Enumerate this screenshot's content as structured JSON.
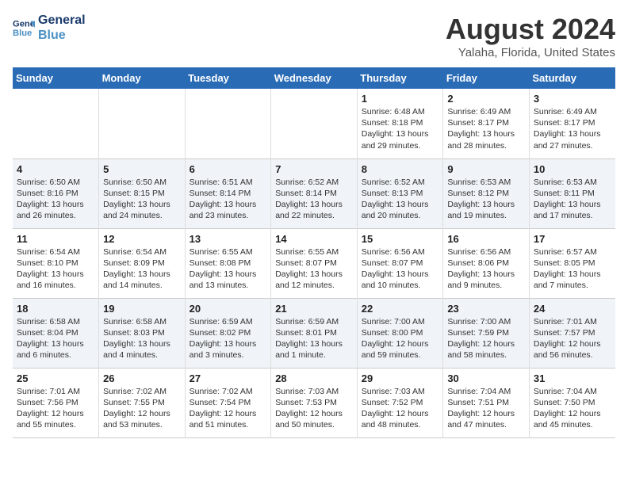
{
  "logo": {
    "line1": "General",
    "line2": "Blue"
  },
  "title": "August 2024",
  "subtitle": "Yalaha, Florida, United States",
  "header_color": "#2a6bb5",
  "days_of_week": [
    "Sunday",
    "Monday",
    "Tuesday",
    "Wednesday",
    "Thursday",
    "Friday",
    "Saturday"
  ],
  "weeks": [
    [
      {
        "day": "",
        "text": ""
      },
      {
        "day": "",
        "text": ""
      },
      {
        "day": "",
        "text": ""
      },
      {
        "day": "",
        "text": ""
      },
      {
        "day": "1",
        "text": "Sunrise: 6:48 AM\nSunset: 8:18 PM\nDaylight: 13 hours\nand 29 minutes."
      },
      {
        "day": "2",
        "text": "Sunrise: 6:49 AM\nSunset: 8:17 PM\nDaylight: 13 hours\nand 28 minutes."
      },
      {
        "day": "3",
        "text": "Sunrise: 6:49 AM\nSunset: 8:17 PM\nDaylight: 13 hours\nand 27 minutes."
      }
    ],
    [
      {
        "day": "4",
        "text": "Sunrise: 6:50 AM\nSunset: 8:16 PM\nDaylight: 13 hours\nand 26 minutes."
      },
      {
        "day": "5",
        "text": "Sunrise: 6:50 AM\nSunset: 8:15 PM\nDaylight: 13 hours\nand 24 minutes."
      },
      {
        "day": "6",
        "text": "Sunrise: 6:51 AM\nSunset: 8:14 PM\nDaylight: 13 hours\nand 23 minutes."
      },
      {
        "day": "7",
        "text": "Sunrise: 6:52 AM\nSunset: 8:14 PM\nDaylight: 13 hours\nand 22 minutes."
      },
      {
        "day": "8",
        "text": "Sunrise: 6:52 AM\nSunset: 8:13 PM\nDaylight: 13 hours\nand 20 minutes."
      },
      {
        "day": "9",
        "text": "Sunrise: 6:53 AM\nSunset: 8:12 PM\nDaylight: 13 hours\nand 19 minutes."
      },
      {
        "day": "10",
        "text": "Sunrise: 6:53 AM\nSunset: 8:11 PM\nDaylight: 13 hours\nand 17 minutes."
      }
    ],
    [
      {
        "day": "11",
        "text": "Sunrise: 6:54 AM\nSunset: 8:10 PM\nDaylight: 13 hours\nand 16 minutes."
      },
      {
        "day": "12",
        "text": "Sunrise: 6:54 AM\nSunset: 8:09 PM\nDaylight: 13 hours\nand 14 minutes."
      },
      {
        "day": "13",
        "text": "Sunrise: 6:55 AM\nSunset: 8:08 PM\nDaylight: 13 hours\nand 13 minutes."
      },
      {
        "day": "14",
        "text": "Sunrise: 6:55 AM\nSunset: 8:07 PM\nDaylight: 13 hours\nand 12 minutes."
      },
      {
        "day": "15",
        "text": "Sunrise: 6:56 AM\nSunset: 8:07 PM\nDaylight: 13 hours\nand 10 minutes."
      },
      {
        "day": "16",
        "text": "Sunrise: 6:56 AM\nSunset: 8:06 PM\nDaylight: 13 hours\nand 9 minutes."
      },
      {
        "day": "17",
        "text": "Sunrise: 6:57 AM\nSunset: 8:05 PM\nDaylight: 13 hours\nand 7 minutes."
      }
    ],
    [
      {
        "day": "18",
        "text": "Sunrise: 6:58 AM\nSunset: 8:04 PM\nDaylight: 13 hours\nand 6 minutes."
      },
      {
        "day": "19",
        "text": "Sunrise: 6:58 AM\nSunset: 8:03 PM\nDaylight: 13 hours\nand 4 minutes."
      },
      {
        "day": "20",
        "text": "Sunrise: 6:59 AM\nSunset: 8:02 PM\nDaylight: 13 hours\nand 3 minutes."
      },
      {
        "day": "21",
        "text": "Sunrise: 6:59 AM\nSunset: 8:01 PM\nDaylight: 13 hours\nand 1 minute."
      },
      {
        "day": "22",
        "text": "Sunrise: 7:00 AM\nSunset: 8:00 PM\nDaylight: 12 hours\nand 59 minutes."
      },
      {
        "day": "23",
        "text": "Sunrise: 7:00 AM\nSunset: 7:59 PM\nDaylight: 12 hours\nand 58 minutes."
      },
      {
        "day": "24",
        "text": "Sunrise: 7:01 AM\nSunset: 7:57 PM\nDaylight: 12 hours\nand 56 minutes."
      }
    ],
    [
      {
        "day": "25",
        "text": "Sunrise: 7:01 AM\nSunset: 7:56 PM\nDaylight: 12 hours\nand 55 minutes."
      },
      {
        "day": "26",
        "text": "Sunrise: 7:02 AM\nSunset: 7:55 PM\nDaylight: 12 hours\nand 53 minutes."
      },
      {
        "day": "27",
        "text": "Sunrise: 7:02 AM\nSunset: 7:54 PM\nDaylight: 12 hours\nand 51 minutes."
      },
      {
        "day": "28",
        "text": "Sunrise: 7:03 AM\nSunset: 7:53 PM\nDaylight: 12 hours\nand 50 minutes."
      },
      {
        "day": "29",
        "text": "Sunrise: 7:03 AM\nSunset: 7:52 PM\nDaylight: 12 hours\nand 48 minutes."
      },
      {
        "day": "30",
        "text": "Sunrise: 7:04 AM\nSunset: 7:51 PM\nDaylight: 12 hours\nand 47 minutes."
      },
      {
        "day": "31",
        "text": "Sunrise: 7:04 AM\nSunset: 7:50 PM\nDaylight: 12 hours\nand 45 minutes."
      }
    ]
  ]
}
